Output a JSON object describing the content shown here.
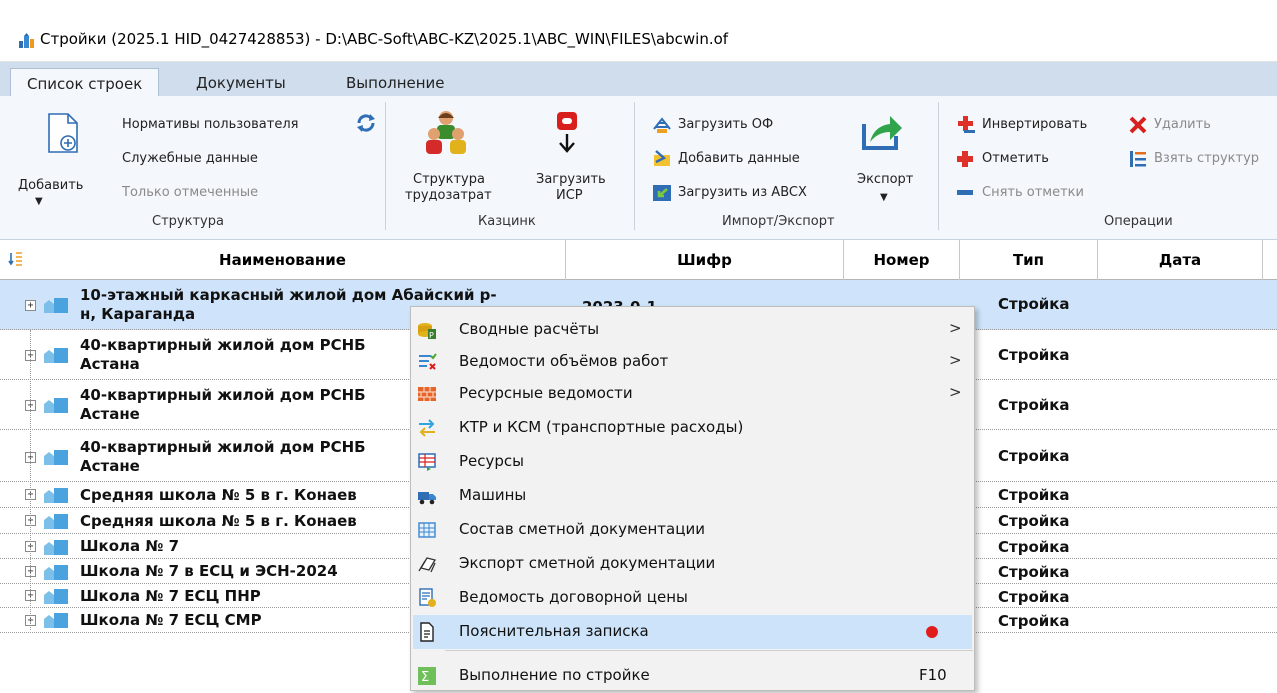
{
  "window": {
    "title": "Стройки (2025.1 HID_0427428853) - D:\\ABC-Soft\\ABC-KZ\\2025.1\\ABC_WIN\\FILES\\abcwin.of"
  },
  "tabs": [
    "Список строек",
    "Документы",
    "Выполнение"
  ],
  "ribbon": {
    "structure": {
      "add_label": "Добавить",
      "user_norms": "Нормативы пользователя",
      "service_data": "Служебные данные",
      "only_marked": "Только отмеченные",
      "group": "Структура"
    },
    "kazcink": {
      "labor_structure_l1": "Структура",
      "labor_structure_l2": "трудозатрат",
      "load_isr_l1": "Загрузить",
      "load_isr_l2": "ИСР",
      "group": "Казцинк"
    },
    "import_export": {
      "load_of": "Загрузить ОФ",
      "add_data": "Добавить данные",
      "load_abcx": "Загрузить из ABCX",
      "export_label": "Экспорт",
      "group": "Импорт/Экспорт"
    },
    "operations": {
      "invert": "Инвертировать",
      "mark": "Отметить",
      "unmark": "Снять отметки",
      "delete": "Удалить",
      "take_structure": "Взять структур",
      "group": "Операции"
    }
  },
  "grid": {
    "columns": [
      "Наименование",
      "Шифр",
      "Номер",
      "Тип",
      "Дата"
    ],
    "rows": [
      {
        "name_l1": "10-этажный каркасный жилой дом Абайский р-",
        "name_l2": "н, Караганда",
        "code": "2023-0-1",
        "type": "Стройка"
      },
      {
        "name_l1": "40-квартирный жилой дом РСНБ",
        "name_l2": "Астана",
        "type": "Стройка"
      },
      {
        "name_l1": "40-квартирный жилой дом РСНБ",
        "name_l2": "Астане",
        "type": "Стройка"
      },
      {
        "name_l1": "40-квартирный жилой дом РСНБ",
        "name_l2": "Астане",
        "type": "Стройка"
      },
      {
        "name_l1": "Средняя школа № 5 в г. Конаев",
        "type": "Стройка"
      },
      {
        "name_l1": "Средняя школа № 5 в г. Конаев",
        "type": "Стройка"
      },
      {
        "name_l1": "Школа № 7",
        "type": "Стройка"
      },
      {
        "name_l1": "Школа № 7 в ЕСЦ и ЭСН-2024",
        "type": "Стройка"
      },
      {
        "name_l1": "Школа № 7 ЕСЦ ПНР",
        "type": "Стройка"
      },
      {
        "name_l1": "Школа № 7 ЕСЦ СМР",
        "type": "Стройка"
      }
    ]
  },
  "context_menu": {
    "items": [
      {
        "label": "Сводные расчёты",
        "submenu": ">"
      },
      {
        "label": "Ведомости объёмов работ",
        "submenu": ">"
      },
      {
        "label": "Ресурсные ведомости",
        "submenu": ">"
      },
      {
        "label": "КТР и КСМ (транспортные расходы)"
      },
      {
        "label": "Ресурсы"
      },
      {
        "label": "Машины"
      },
      {
        "label": "Состав сметной документации"
      },
      {
        "label": "Экспорт сметной документации"
      },
      {
        "label": "Ведомость договорной цены"
      },
      {
        "label": "Пояснительная записка"
      },
      {
        "label": "Выполнение по стройке",
        "shortcut": "F10"
      }
    ],
    "highlighted_index": 9,
    "accent_dot_color": "#e21b1b"
  }
}
